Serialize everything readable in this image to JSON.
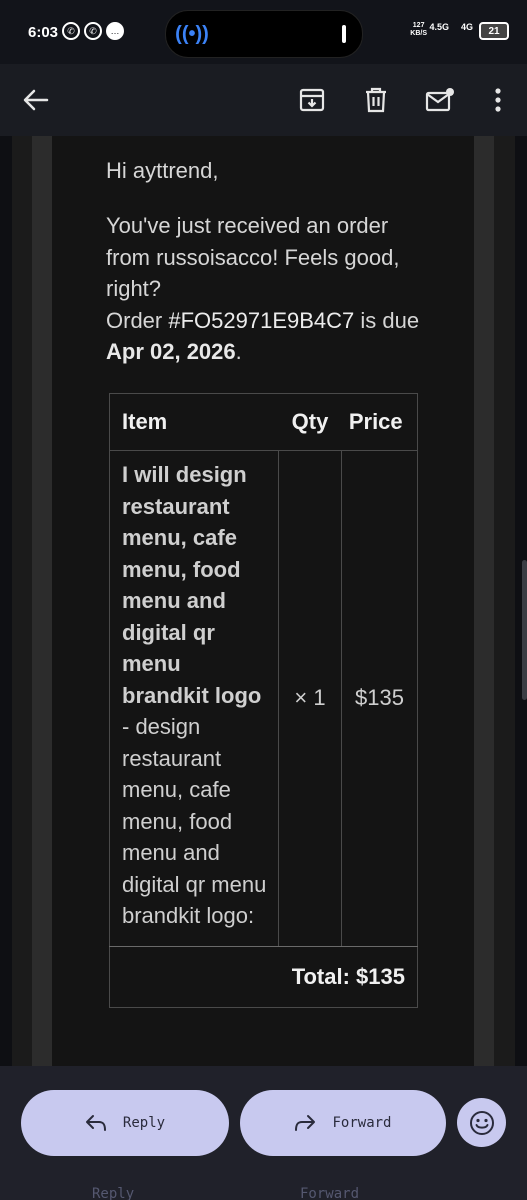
{
  "status_bar": {
    "time": "6:03",
    "net_speed": "127",
    "net_unit": "KB/S",
    "signal1": "4.5G",
    "signal2": "4G",
    "battery": "21"
  },
  "email": {
    "greeting": "Hi ayttrend,",
    "line1": "You've just received an order from russoisacco! Feels good, right?",
    "order_prefix": "Order ",
    "order_id": "#FO52971E9B4C7",
    "order_mid": " is due ",
    "due_date": "Apr 02, 2026",
    "order_suffix": "."
  },
  "table": {
    "headers": {
      "item": "Item",
      "qty": "Qty",
      "price": "Price"
    },
    "row": {
      "title": "I will design restaurant menu, cafe menu, food menu and digital qr menu brandkit logo",
      "desc": " - design restaurant menu, cafe menu, food menu and digital qr menu brandkit logo:",
      "qty": "× 1",
      "price": "$135"
    },
    "total": "Total: $135"
  },
  "bottom": {
    "reply_label": "Reply",
    "forward_label": "Forward"
  },
  "icons": {
    "back": "arrow-left-icon",
    "archive": "archive-icon",
    "trash": "trash-icon",
    "mail": "mark-unread-icon",
    "more": "more-vert-icon",
    "emoji": "emoji-icon"
  },
  "colors": {
    "accent": "#c8c9ef",
    "background": "#0e0f13",
    "card": "#141414"
  }
}
